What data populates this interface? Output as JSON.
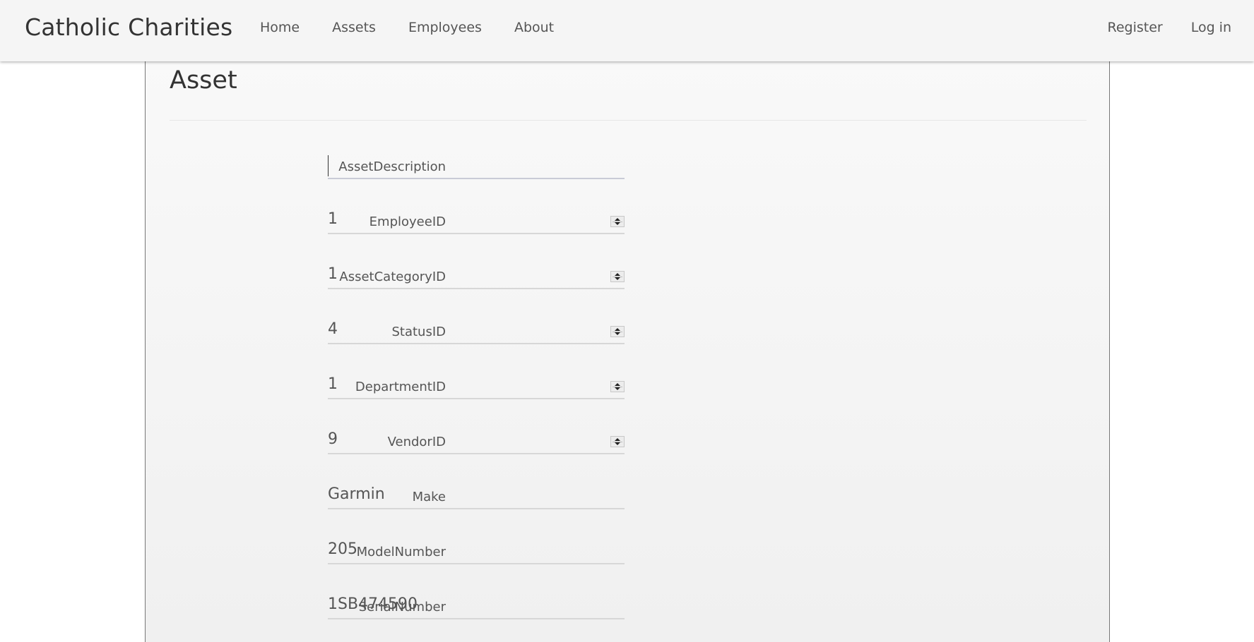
{
  "navbar": {
    "brand": "Catholic Charities",
    "left_links": [
      "Home",
      "Assets",
      "Employees",
      "About"
    ],
    "right_links": [
      "Register",
      "Log in"
    ]
  },
  "page": {
    "title": "Asset"
  },
  "form": {
    "fields": [
      {
        "label": "AssetDescription",
        "value": "",
        "type": "text"
      },
      {
        "label": "EmployeeID",
        "value": "1",
        "type": "number"
      },
      {
        "label": "AssetCategoryID",
        "value": "1",
        "type": "number"
      },
      {
        "label": "StatusID",
        "value": "4",
        "type": "number"
      },
      {
        "label": "DepartmentID",
        "value": "1",
        "type": "number"
      },
      {
        "label": "VendorID",
        "value": "9",
        "type": "number"
      },
      {
        "label": "Make",
        "value": "Garmin",
        "type": "text"
      },
      {
        "label": "ModelNumber",
        "value": "205",
        "type": "text"
      },
      {
        "label": "SerialNumber",
        "value": "1SB474590",
        "type": "text"
      }
    ]
  },
  "colors": {
    "navbar_bg": "#f5f5f5",
    "panel_border": "#777777",
    "field_underline": "#d7d7d7"
  }
}
